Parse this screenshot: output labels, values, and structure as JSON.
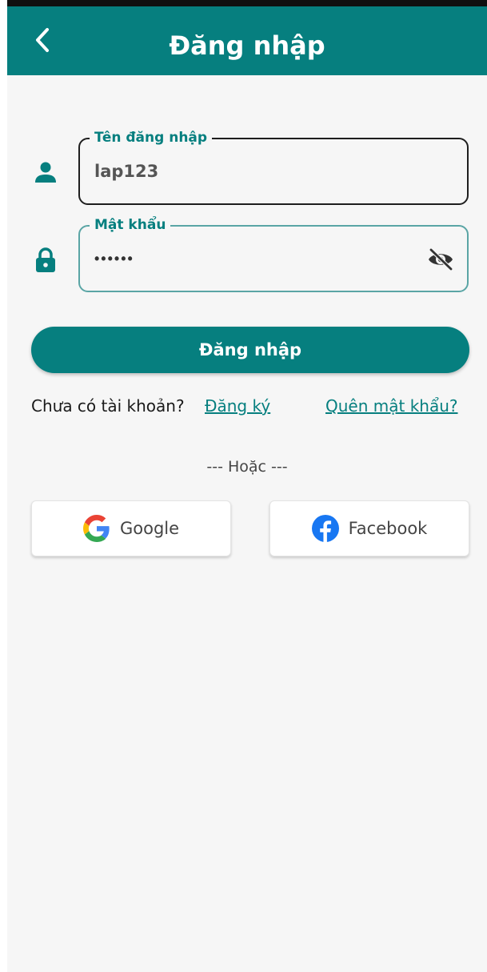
{
  "appbar": {
    "title": "Đăng nhập",
    "back_icon": "chevron-left-icon"
  },
  "form": {
    "username": {
      "label": "Tên đăng nhập",
      "value": "lap123",
      "icon": "person-icon"
    },
    "password": {
      "label": "Mật khẩu",
      "masked_value": "••••••",
      "icon": "lock-icon",
      "visibility_icon": "eye-off-icon"
    },
    "submit_label": "Đăng nhập"
  },
  "links": {
    "no_account_text": "Chưa có tài khoản?",
    "register_label": "Đăng ký",
    "forgot_password_label": "Quên mật khẩu?"
  },
  "divider_text": "--- Hoặc ---",
  "social": {
    "google_label": "Google",
    "facebook_label": "Facebook"
  },
  "colors": {
    "primary": "#067f7f",
    "background": "#f6f6f6",
    "facebook": "#1877f2"
  }
}
